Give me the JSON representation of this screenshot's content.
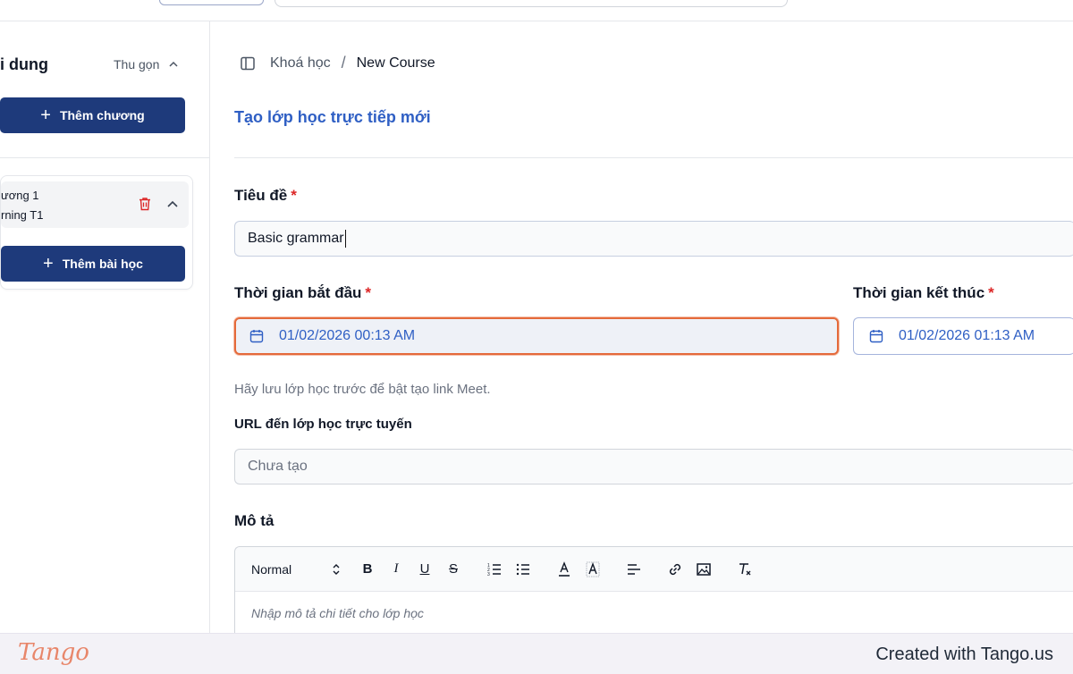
{
  "sidebar": {
    "title": "i dung",
    "collapse_label": "Thu gọn",
    "add_chapter_label": "Thêm chương",
    "chapter": {
      "line1": "ương 1",
      "line2": "rning T1"
    },
    "add_lesson_label": "Thêm bài học"
  },
  "breadcrumb": {
    "link": "Khoá học",
    "separator": "/",
    "current": "New Course"
  },
  "page": {
    "title": "Tạo lớp học trực tiếp mới"
  },
  "form": {
    "title_label": "Tiêu đề",
    "title_value": "Basic grammar",
    "required_mark": "*",
    "start_label": "Thời gian bắt đầu",
    "start_value": "01/02/2026 00:13 AM",
    "end_label": "Thời gian kết thúc",
    "end_value": "01/02/2026 01:13 AM",
    "meet_hint": "Hãy lưu lớp học trước để bật tạo link Meet.",
    "url_label": "URL đến lớp học trực tuyến",
    "url_placeholder": "Chưa tạo",
    "description_label": "Mô tả",
    "editor": {
      "format_select": "Normal",
      "bold": "B",
      "italic": "I",
      "underline": "U",
      "strike": "S",
      "placeholder": "Nhập mô tả chi tiết cho lớp học"
    }
  },
  "footer": {
    "logo_text": "Tango",
    "created_text": "Created with Tango.us"
  },
  "colors": {
    "primary": "#1e3a7b",
    "accent_blue": "#2f5fc4",
    "focus_orange": "#e46a3b",
    "required_red": "#dc2626"
  }
}
